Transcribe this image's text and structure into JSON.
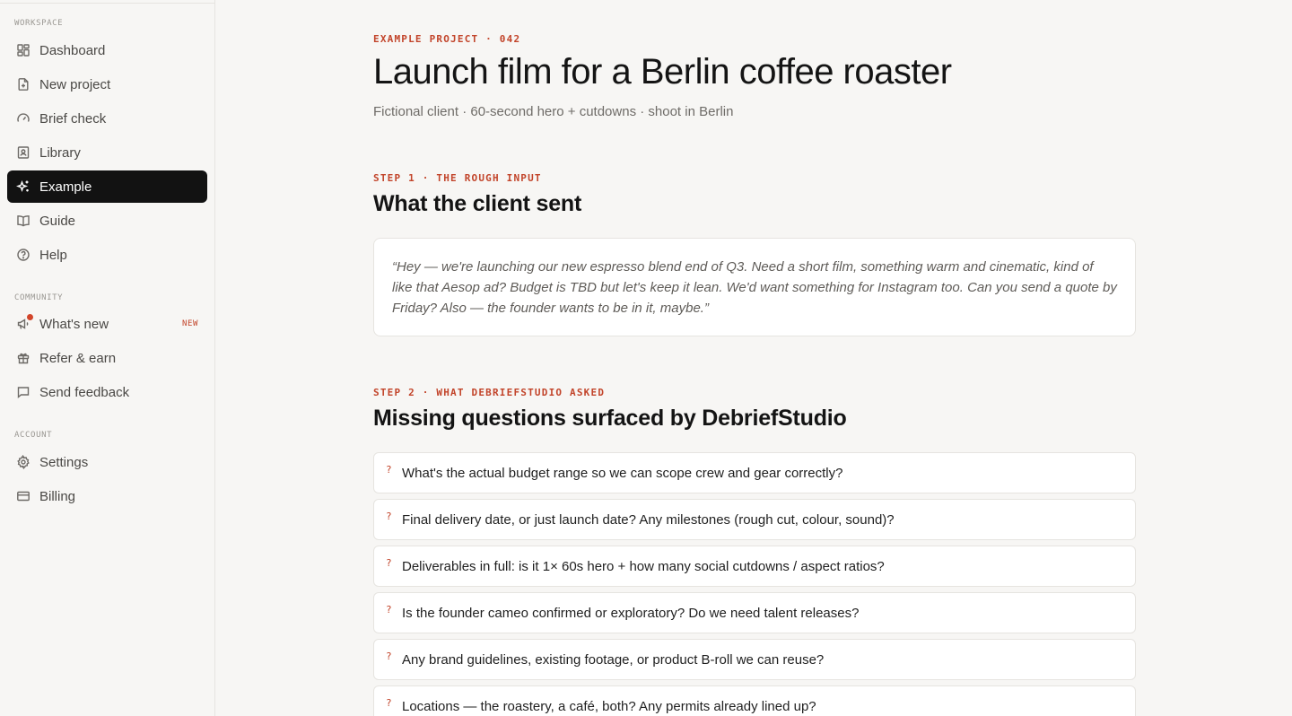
{
  "sidebar": {
    "sections": {
      "workspace": "WORKSPACE",
      "community": "COMMUNITY",
      "account": "ACCOUNT"
    },
    "items": {
      "dashboard": "Dashboard",
      "new_project": "New project",
      "brief_check": "Brief check",
      "library": "Library",
      "example": "Example",
      "guide": "Guide",
      "help": "Help",
      "whats_new": "What's new",
      "whats_new_tag": "NEW",
      "refer": "Refer & earn",
      "feedback": "Send feedback",
      "settings": "Settings",
      "billing": "Billing"
    }
  },
  "header": {
    "eyebrow": "EXAMPLE PROJECT · 042",
    "title": "Launch film for a Berlin coffee roaster",
    "subtitle": "Fictional client · 60-second hero + cutdowns · shoot in Berlin"
  },
  "step1": {
    "eyebrow": "STEP 1 · THE ROUGH INPUT",
    "title": "What the client sent",
    "quote": "“Hey — we're launching our new espresso blend end of Q3. Need a short film, something warm and cinematic, kind of like that Aesop ad? Budget is TBD but let's keep it lean. We'd want something for Instagram too. Can you send a quote by Friday? Also — the founder wants to be in it, maybe.”"
  },
  "step2": {
    "eyebrow": "STEP 2 · WHAT DEBRIEFSTUDIO ASKED",
    "title": "Missing questions surfaced by DebriefStudio",
    "mark": "?",
    "questions": [
      "What's the actual budget range so we can scope crew and gear correctly?",
      "Final delivery date, or just launch date? Any milestones (rough cut, colour, sound)?",
      "Deliverables in full: is it 1× 60s hero + how many social cutdowns / aspect ratios?",
      "Is the founder cameo confirmed or exploratory? Do we need talent releases?",
      "Any brand guidelines, existing footage, or product B-roll we can reuse?",
      "Locations — the roastery, a café, both? Any permits already lined up?"
    ]
  },
  "colors": {
    "accent": "#c2442a",
    "active_bg": "#121212",
    "page_bg": "#f7f6f4",
    "card_bg": "#ffffff"
  }
}
